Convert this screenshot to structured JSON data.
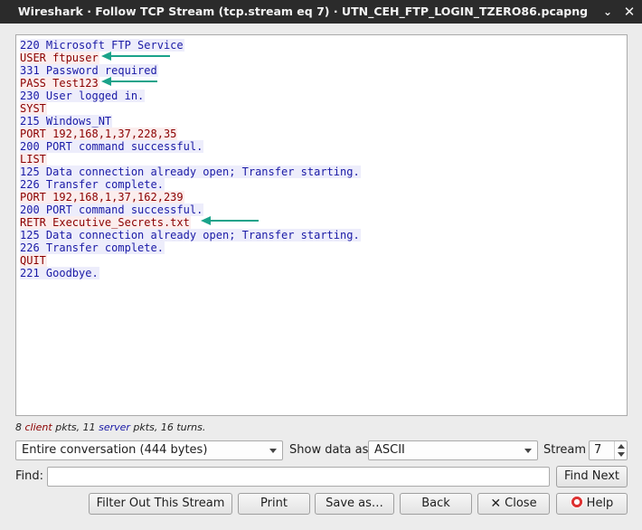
{
  "window": {
    "title": "Wireshark · Follow TCP Stream (tcp.stream eq 7) · UTN_CEH_FTP_LOGIN_TZERO86.pcapng",
    "minimize_glyph": "⌄",
    "close_glyph": "✕"
  },
  "stream": {
    "lines": [
      {
        "dir": "server",
        "text": "220 Microsoft FTP Service"
      },
      {
        "dir": "client",
        "text": "USER ftpuser"
      },
      {
        "dir": "server",
        "text": "331 Password required"
      },
      {
        "dir": "client",
        "text": "PASS Test123"
      },
      {
        "dir": "server",
        "text": "230 User logged in."
      },
      {
        "dir": "client",
        "text": "SYST"
      },
      {
        "dir": "server",
        "text": "215 Windows_NT"
      },
      {
        "dir": "client",
        "text": "PORT 192,168,1,37,228,35"
      },
      {
        "dir": "server",
        "text": "200 PORT command successful."
      },
      {
        "dir": "client",
        "text": "LIST"
      },
      {
        "dir": "server",
        "text": "125 Data connection already open; Transfer starting."
      },
      {
        "dir": "server",
        "text": "226 Transfer complete."
      },
      {
        "dir": "client",
        "text": "PORT 192,168,1,37,162,239"
      },
      {
        "dir": "server",
        "text": "200 PORT command successful."
      },
      {
        "dir": "client",
        "text": "RETR Executive_Secrets.txt"
      },
      {
        "dir": "server",
        "text": "125 Data connection already open; Transfer starting."
      },
      {
        "dir": "server",
        "text": "226 Transfer complete."
      },
      {
        "dir": "client",
        "text": "QUIT"
      },
      {
        "dir": "server",
        "text": "221 Goodbye."
      }
    ],
    "annotation_color": "#1aa38a",
    "client_color": "#8b0000",
    "server_color": "#1a1aa6"
  },
  "stats": {
    "client_count": "8",
    "client_word": "client",
    "pkts_sep": " pkts, ",
    "server_count": "11",
    "server_word": "server",
    "tail": " pkts, 16 turns."
  },
  "controls": {
    "conversation_select": "Entire conversation (444 bytes)",
    "show_data_label": "Show data as",
    "format_select": "ASCII",
    "stream_label": "Stream",
    "stream_value": "7",
    "find_label": "Find:",
    "find_value": "",
    "find_next_label": "Find Next"
  },
  "buttons": {
    "filter_out": "Filter Out This Stream",
    "print": "Print",
    "save_as": "Save as…",
    "back": "Back",
    "close": "Close",
    "help": "Help"
  }
}
